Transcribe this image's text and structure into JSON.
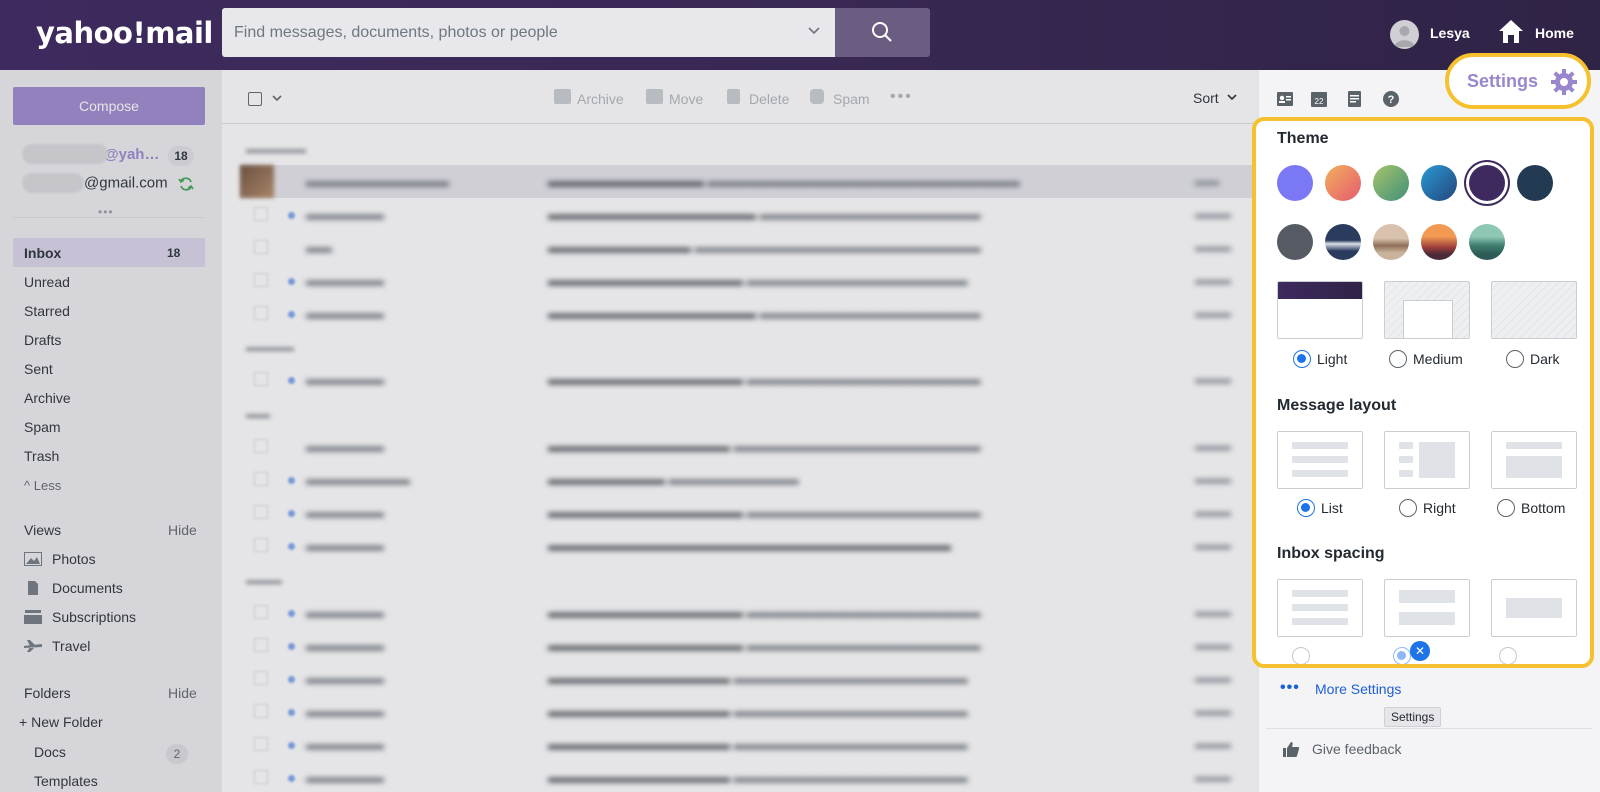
{
  "header": {
    "logo": "yahoo!mail",
    "search_placeholder": "Find messages, documents, photos or people",
    "user_name": "Lesya",
    "home_label": "Home"
  },
  "sidebar": {
    "compose_label": "Compose",
    "accounts": [
      {
        "label": "@yah…",
        "count": "18"
      },
      {
        "label": "@gmail.com"
      }
    ],
    "nav": [
      {
        "label": "Inbox",
        "count": "18"
      },
      {
        "label": "Unread"
      },
      {
        "label": "Starred"
      },
      {
        "label": "Drafts"
      },
      {
        "label": "Sent"
      },
      {
        "label": "Archive"
      },
      {
        "label": "Spam"
      },
      {
        "label": "Trash"
      }
    ],
    "less_label": "Less",
    "views_title": "Views",
    "views_hide": "Hide",
    "views": [
      {
        "label": "Photos",
        "icon": "photos-icon"
      },
      {
        "label": "Documents",
        "icon": "documents-icon"
      },
      {
        "label": "Subscriptions",
        "icon": "subscriptions-icon"
      },
      {
        "label": "Travel",
        "icon": "travel-icon"
      }
    ],
    "folders_title": "Folders",
    "folders_hide": "Hide",
    "new_folder_label": "New Folder",
    "folders": [
      {
        "label": "Docs",
        "count": "2"
      },
      {
        "label": "Templates"
      }
    ]
  },
  "toolbar": {
    "archive_label": "Archive",
    "move_label": "Move",
    "delete_label": "Delete",
    "spam_label": "Spam",
    "sort_label": "Sort"
  },
  "rail": {
    "settings_label": "Settings",
    "more_settings_label": "More Settings",
    "tooltip_label": "Settings",
    "feedback_label": "Give feedback"
  },
  "settings_panel": {
    "theme_title": "Theme",
    "swatches": [
      "#7b78f5",
      "#f08a5d",
      "#5fa874",
      "#2b6aa8",
      "#3e2a5e",
      "#223a52",
      "#565a63",
      "#2a3b5e",
      "#b9a08a",
      "#d96a3e",
      "#3f7d6e"
    ],
    "selected_swatch": 4,
    "theme_modes": [
      {
        "label": "Light",
        "selected": true
      },
      {
        "label": "Medium",
        "selected": false
      },
      {
        "label": "Dark",
        "selected": false
      }
    ],
    "layout_title": "Message layout",
    "layouts": [
      {
        "label": "List",
        "selected": true
      },
      {
        "label": "Right",
        "selected": false
      },
      {
        "label": "Bottom",
        "selected": false
      }
    ],
    "spacing_title": "Inbox spacing"
  },
  "colors": {
    "accent": "#9a86cc",
    "highlight_border": "#f5c12e",
    "link": "#1d5fd6",
    "header_bg": "#3e2a5e"
  }
}
